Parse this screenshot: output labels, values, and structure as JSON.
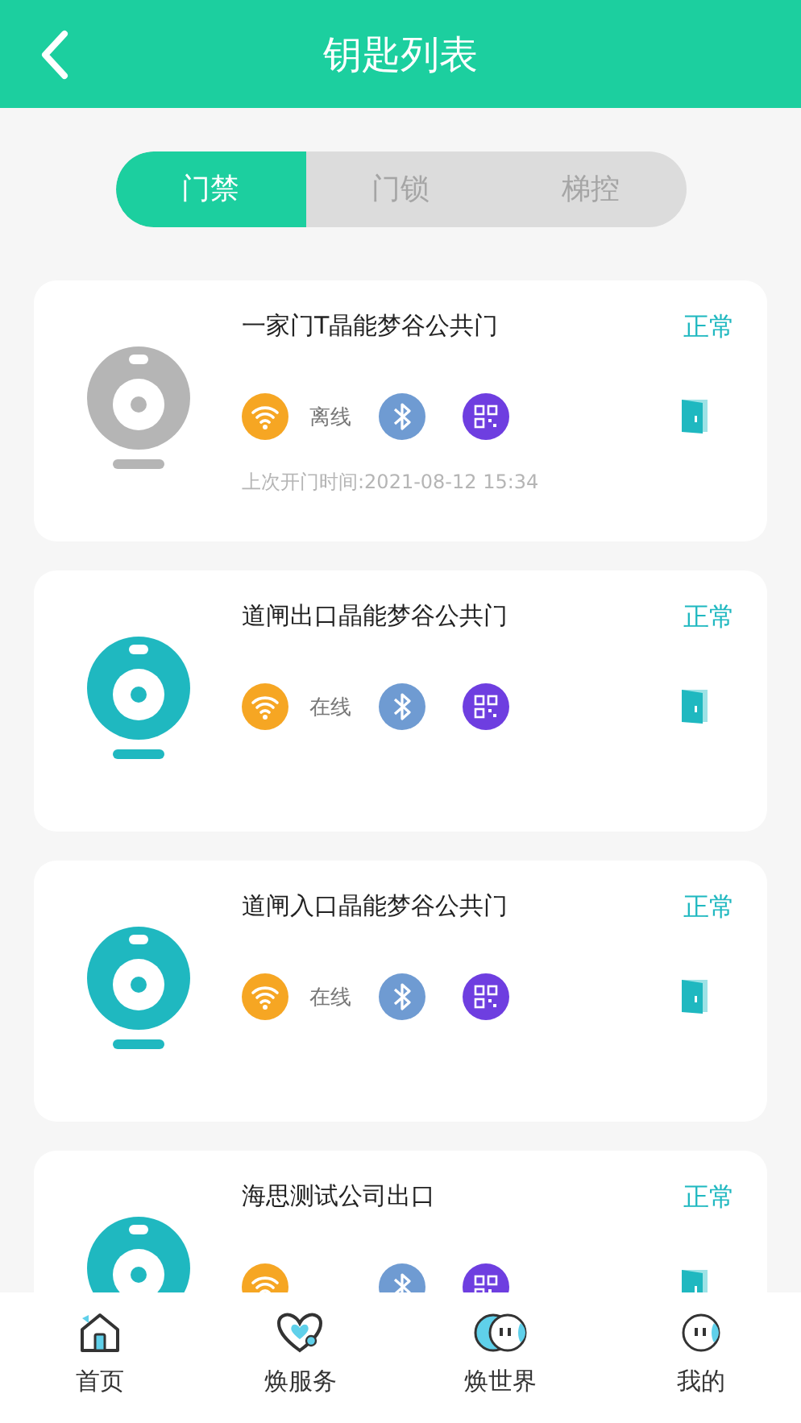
{
  "header": {
    "title": "钥匙列表"
  },
  "tabs": [
    {
      "label": "门禁",
      "selected": true
    },
    {
      "label": "门锁",
      "selected": false
    },
    {
      "label": "梯控",
      "selected": false
    }
  ],
  "devices": [
    {
      "name": "一家门T晶能梦谷公共门",
      "state": "正常",
      "online": false,
      "status": "离线",
      "last_open": "上次开门时间:2021-08-12 15:34"
    },
    {
      "name": "道闸出口晶能梦谷公共门",
      "state": "正常",
      "online": true,
      "status": "在线"
    },
    {
      "name": "道闸入口晶能梦谷公共门",
      "state": "正常",
      "online": true,
      "status": "在线"
    },
    {
      "name": "海思测试公司出口",
      "state": "正常",
      "online": true
    }
  ],
  "nav": [
    {
      "label": "首页",
      "kind": "home"
    },
    {
      "label": "焕服务",
      "kind": "service"
    },
    {
      "label": "焕世界",
      "kind": "world"
    },
    {
      "label": "我的",
      "kind": "mine"
    }
  ]
}
